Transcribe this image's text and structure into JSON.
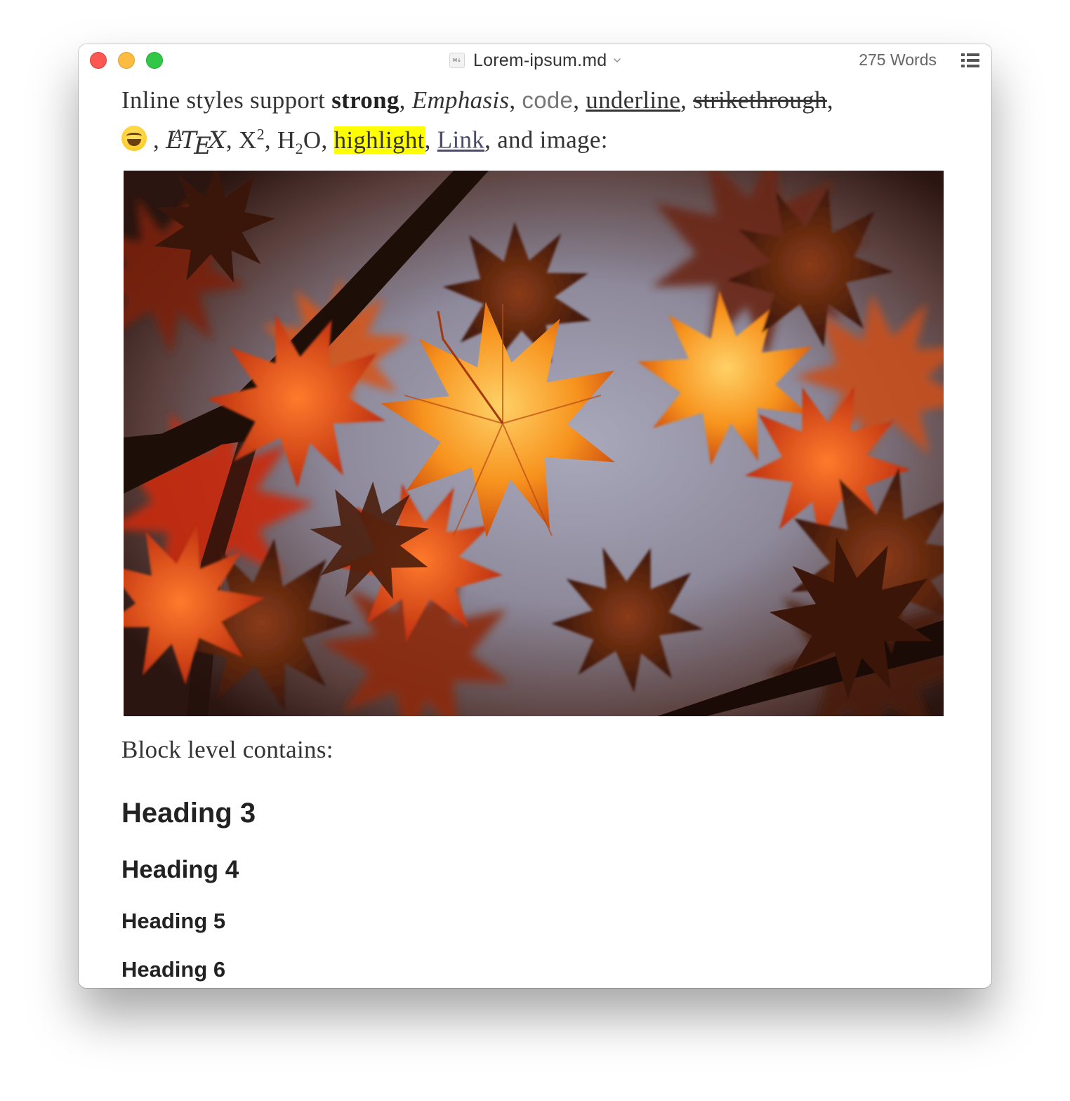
{
  "window": {
    "title": "Lorem-ipsum.md",
    "file_icon_label": "M↓",
    "word_count": "275 Words",
    "chevron_icon": "chevron-down-icon",
    "outline_icon": "list-outline-icon"
  },
  "document": {
    "inline": {
      "intro": "Inline styles support ",
      "strong": "strong",
      "emphasis": "Emphasis",
      "code": "code",
      "underline": "underline",
      "strikethrough": "strikethrough",
      "emoji_icon": "grinning-squinting-face-icon",
      "latex_L": "L",
      "latex_A": "A",
      "latex_T": "T",
      "latex_E": "E",
      "latex_X": "X",
      "x_base": "X",
      "x_sup": "2",
      "h_base": "H",
      "h_sub": "2",
      "h_tail": "O",
      "highlight": "highlight",
      "link": "Link",
      "tail": ", and image:"
    },
    "image_alt": "Autumn maple leaves",
    "block_text": "Block level contains:",
    "headings": {
      "h3": "Heading 3",
      "h4": "Heading 4",
      "h5": "Heading 5",
      "h6": "Heading 6"
    }
  },
  "colors": {
    "close": "#fc5753",
    "minimize": "#fdbc40",
    "zoom": "#33c748",
    "highlight": "#ffff00"
  }
}
